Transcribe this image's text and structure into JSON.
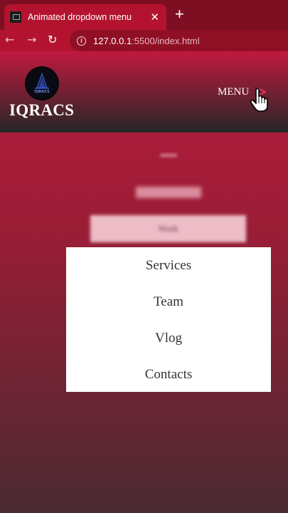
{
  "browser": {
    "tab_title": "Animated dropdown menu",
    "tab_close": "✕",
    "new_tab": "+",
    "url_host": "127.0.0.1",
    "url_rest": ":5500/index.html"
  },
  "site": {
    "logo_text": "IQRACS",
    "brand": "IQRACS",
    "menu_label": "MENU"
  },
  "dropdown": {
    "items": [
      {
        "label": "Work"
      },
      {
        "label": "Services"
      },
      {
        "label": "Team"
      },
      {
        "label": "Vlog"
      },
      {
        "label": "Contacts"
      }
    ]
  },
  "colors": {
    "accent": "#c0193f",
    "menu_arrow": "#e8335b",
    "dropdown_bg": "#ffffff"
  },
  "icons": {
    "back": "arrow-left-icon",
    "forward": "arrow-right-icon",
    "reload": "reload-icon",
    "info": "info-icon",
    "menu_arrow": "triangle-right-icon",
    "cursor": "hand-pointer-icon"
  }
}
